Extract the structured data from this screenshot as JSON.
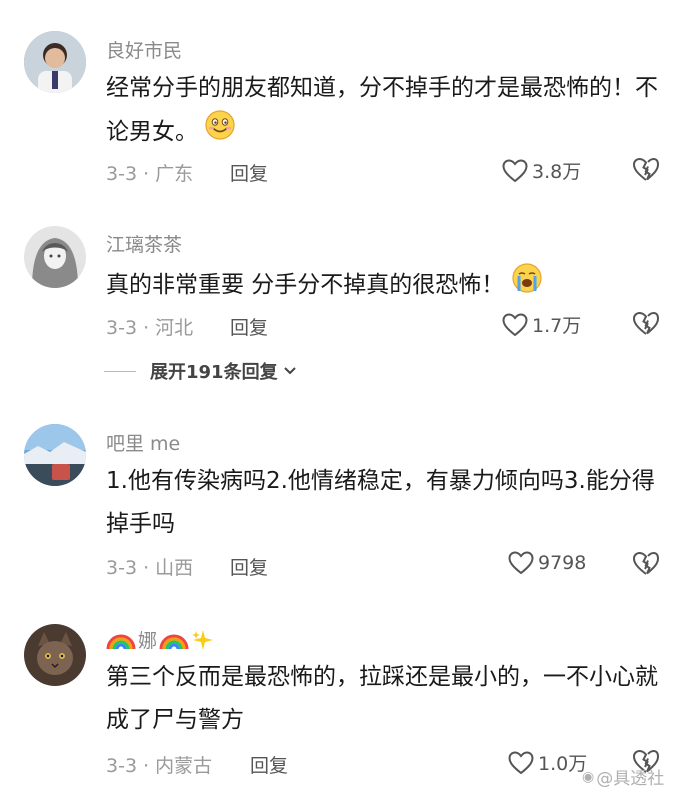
{
  "comments": [
    {
      "username": "良好市民",
      "text": "经常分手的朋友都知道，分不掉手的才是最恐怖的！不论男女。",
      "meta": "3-3 · 广东",
      "reply": "回复",
      "likes": "3.8万"
    },
    {
      "username": "江璃茶茶",
      "text": "真的非常重要 分手分不掉真的很恐怖！",
      "meta": "3-3 · 河北",
      "reply": "回复",
      "likes": "1.7万",
      "expand_label": "展开191条回复"
    },
    {
      "username": "吧里 me",
      "text": "1.他有传染病吗2.他情绪稳定，有暴力倾向吗3.能分得掉手吗",
      "meta": "3-3 · 山西",
      "reply": "回复",
      "likes": "9798"
    },
    {
      "username": "娜",
      "text": "第三个反而是最恐怖的，拉踩还是最小的，一不小心就成了尸与警方",
      "meta": "3-3 · 内蒙古",
      "reply": "回复",
      "likes": "1.0万"
    }
  ],
  "watermark": "@具透社"
}
